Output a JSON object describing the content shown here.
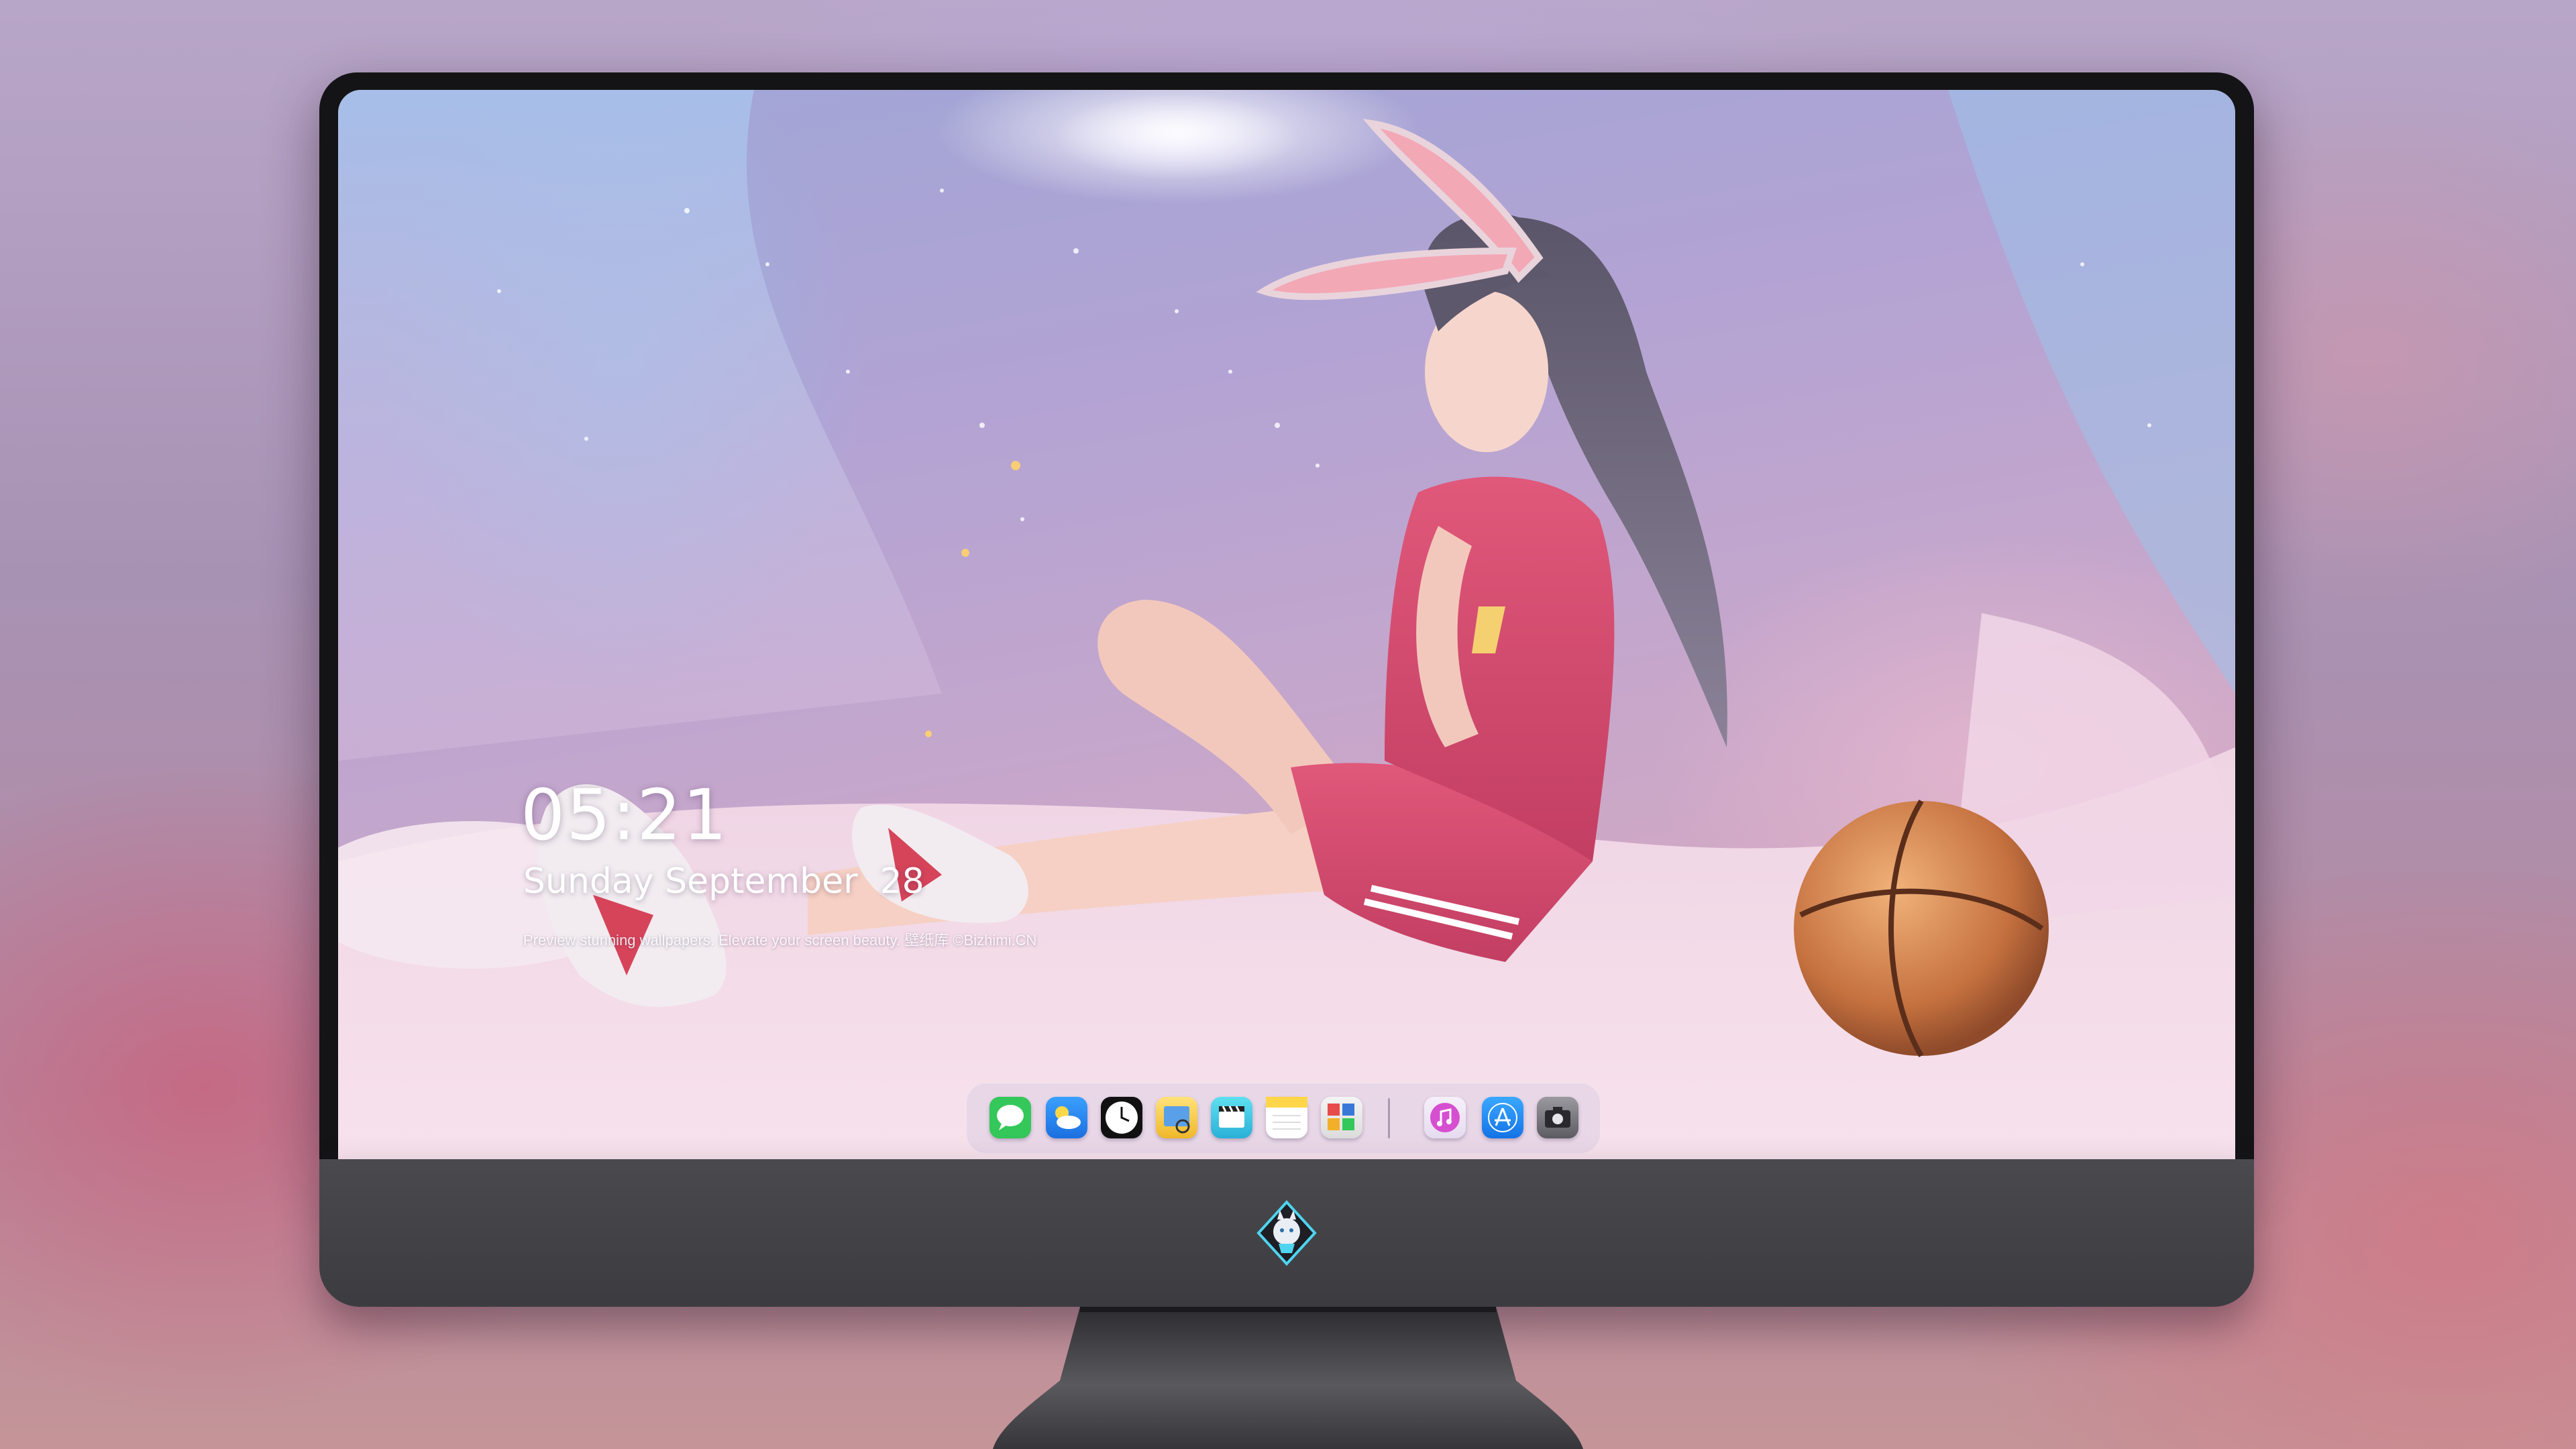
{
  "lock_screen": {
    "time": "05:21",
    "date": "Sunday September  28",
    "caption": "Preview stunning wallpapers. Elevate your screen beauty. 壁纸库 ©Bizhimi.CN"
  },
  "dock": {
    "apps": [
      {
        "name": "Messages",
        "icon": "messages-icon",
        "color": "#34c759"
      },
      {
        "name": "Weather",
        "icon": "weather-icon",
        "color": "#2f8cf0"
      },
      {
        "name": "Clock",
        "icon": "clock-icon",
        "color": "#111111"
      },
      {
        "name": "Preview",
        "icon": "preview-icon",
        "color": "#f2c230"
      },
      {
        "name": "Clips",
        "icon": "clips-icon",
        "color": "#38c6e0"
      },
      {
        "name": "Notes",
        "icon": "notes-icon",
        "color": "#ffd54a"
      },
      {
        "name": "Photo Booth",
        "icon": "photo-booth-icon",
        "color": "#3a78d8"
      },
      {
        "name": "iTunes",
        "icon": "itunes-icon",
        "color": "#d64fd0"
      },
      {
        "name": "App Store",
        "icon": "app-store-icon",
        "color": "#1d8ef2"
      },
      {
        "name": "Camera",
        "icon": "camera-icon",
        "color": "#6c6c70"
      }
    ]
  },
  "colors": {
    "bezel": "#141416",
    "chin": "#444448",
    "accent_pink": "#d24a6a"
  }
}
